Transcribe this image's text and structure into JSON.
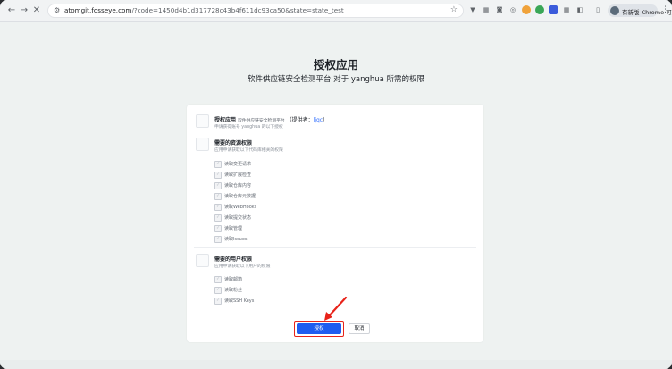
{
  "browser": {
    "url_host": "atomgit.fosseye.com",
    "url_rest": "/?code=1450d4b1d317728c43b4f611dc93ca50&state=state_test",
    "profile_label": "有新版 Chrome 可用"
  },
  "page": {
    "title": "授权应用",
    "subtitle": "软件供应链安全检测平台 对于 yanghua 所需的权限"
  },
  "app_section": {
    "title": "授权应用",
    "app_name": "软件供应链安全检测平台",
    "provider_prefix": "（提供者：",
    "provider_name": "ljqc",
    "provider_suffix": "）",
    "desc": "申请获得账号 yanghua 的以下授权"
  },
  "resource_section": {
    "title": "需要的资源权限",
    "desc": "应用申请获取以下代码库相关的权限",
    "items": [
      "读取变更请求",
      "读取扩展检查",
      "读取仓库内容",
      "读取仓库元数据",
      "读取WebHooks",
      "读取提交状态",
      "读取管理",
      "读取Issues"
    ]
  },
  "user_section": {
    "title": "需要的用户权限",
    "desc": "应用申请获取以下用户的权限",
    "items": [
      "读取邮箱",
      "读取粉丝",
      "读取SSH Keys"
    ]
  },
  "actions": {
    "authorize_label": "授权",
    "cancel_label": "取消"
  },
  "colors": {
    "primary": "#1f5cf0",
    "highlight": "#e8231a",
    "link": "#3370ff"
  }
}
